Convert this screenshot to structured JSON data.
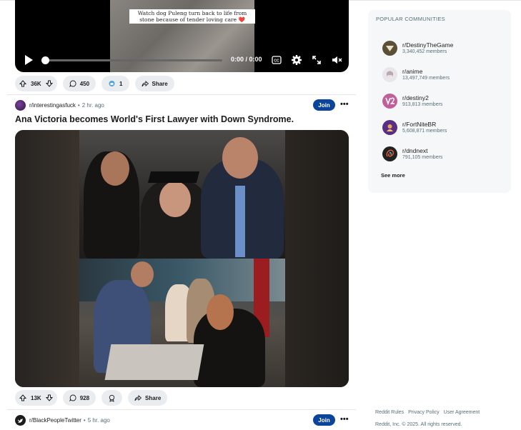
{
  "video_post": {
    "caption": "Watch dog Puleng turn back to life from stone because of tender loving care ❤️",
    "time": "0:00 / 0:00",
    "actions": {
      "upvotes": "36K",
      "comments": "450",
      "awards": "1",
      "share": "Share"
    }
  },
  "post": {
    "subreddit": "r/interestingasfuck",
    "time_ago": "2 hr. ago",
    "separator": "•",
    "join_label": "Join",
    "more": "•••",
    "title": "Ana Victoria becomes World's First Lawyer with Down Syndrome.",
    "actions": {
      "upvotes": "13K",
      "comments": "928",
      "share": "Share"
    }
  },
  "next_post": {
    "subreddit": "r/BlackPeopleTwitter",
    "time_ago": "5 hr. ago",
    "separator": "•",
    "join_label": "Join",
    "more": "•••"
  },
  "sidebar": {
    "title": "POPULAR COMMUNITIES",
    "communities": [
      {
        "name": "r/DestinyTheGame",
        "members": "3,340,452 members",
        "color": "#5b5037"
      },
      {
        "name": "r/anime",
        "members": "13,497,749 members",
        "color": "#e9e6ea"
      },
      {
        "name": "r/destiny2",
        "members": "913,813 members",
        "color": "#c0609b"
      },
      {
        "name": "r/FortNiteBR",
        "members": "5,608,871 members",
        "color": "#5a2e84"
      },
      {
        "name": "r/dndnext",
        "members": "791,105 members",
        "color": "#222222"
      }
    ],
    "see_more": "See more"
  },
  "footer": {
    "links": [
      "Reddit Rules",
      "Privacy Policy",
      "User Agreement"
    ],
    "copyright": "Reddit, Inc. © 2025. All rights reserved."
  },
  "colors": {
    "join": "#0a449b",
    "pill": "#eaedef",
    "sidebar_bg": "#f6f7f8"
  }
}
